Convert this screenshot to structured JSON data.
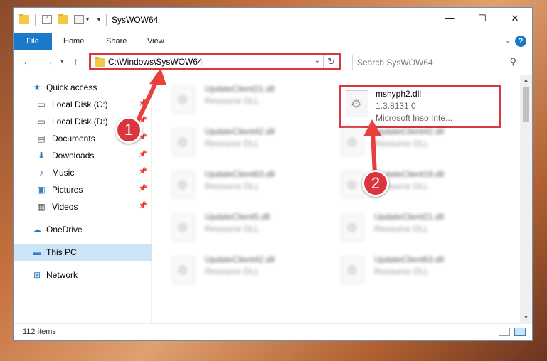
{
  "window": {
    "title": "SysWOW64",
    "controls": {
      "minimize": "—",
      "maximize": "☐",
      "close": "✕"
    }
  },
  "ribbon": {
    "tabs": [
      "File",
      "Home",
      "Share",
      "View"
    ],
    "help": "?"
  },
  "address_bar": {
    "path": "C:\\Windows\\SysWOW64",
    "search_placeholder": "Search SysWOW64"
  },
  "nav_pane": {
    "items": [
      {
        "label": "Quick access",
        "icon": "star-icon",
        "pinned": false
      },
      {
        "label": "Local Disk (C:)",
        "icon": "drive-icon",
        "pinned": true
      },
      {
        "label": "Local Disk (D:)",
        "icon": "drive-icon",
        "pinned": true
      },
      {
        "label": "Documents",
        "icon": "documents-icon",
        "pinned": true
      },
      {
        "label": "Downloads",
        "icon": "download-icon",
        "pinned": true
      },
      {
        "label": "Music",
        "icon": "music-icon",
        "pinned": true
      },
      {
        "label": "Pictures",
        "icon": "pictures-icon",
        "pinned": true
      },
      {
        "label": "Videos",
        "icon": "videos-icon",
        "pinned": true
      },
      {
        "label": "OneDrive",
        "icon": "cloud-icon",
        "pinned": false
      },
      {
        "label": "This PC",
        "icon": "computer-icon",
        "pinned": false,
        "selected": true
      },
      {
        "label": "Network",
        "icon": "network-icon",
        "pinned": false
      }
    ]
  },
  "files": {
    "highlighted": {
      "name": "mshyph2.dll",
      "version": "1.3.8131.0",
      "company": "Microsoft Inso Inte..."
    },
    "left_column": [
      {
        "name": "UpdateClient21.dll",
        "type": "Resource DLL"
      },
      {
        "name": "UpdateClient42.dll",
        "type": "Resource DLL"
      },
      {
        "name": "UpdateClient63.dll",
        "type": "Resource DLL"
      },
      {
        "name": "UpdateClient5.dll",
        "type": "Resource DLL"
      },
      {
        "name": "UpdateClient42.dll",
        "type": "Resource DLL"
      }
    ],
    "right_column": [
      {
        "name": "UpdateClient42.dll",
        "type": "Resource DLL"
      },
      {
        "name": "UpdateClient19.dll",
        "type": "Resource DLL"
      },
      {
        "name": "UpdateClient21.dll",
        "type": "Resource DLL"
      },
      {
        "name": "UpdateClient63.dll",
        "type": "Resource DLL"
      }
    ]
  },
  "status": {
    "item_count": "112 items"
  },
  "callouts": {
    "step1": "1",
    "step2": "2",
    "color": "#d9363e"
  }
}
